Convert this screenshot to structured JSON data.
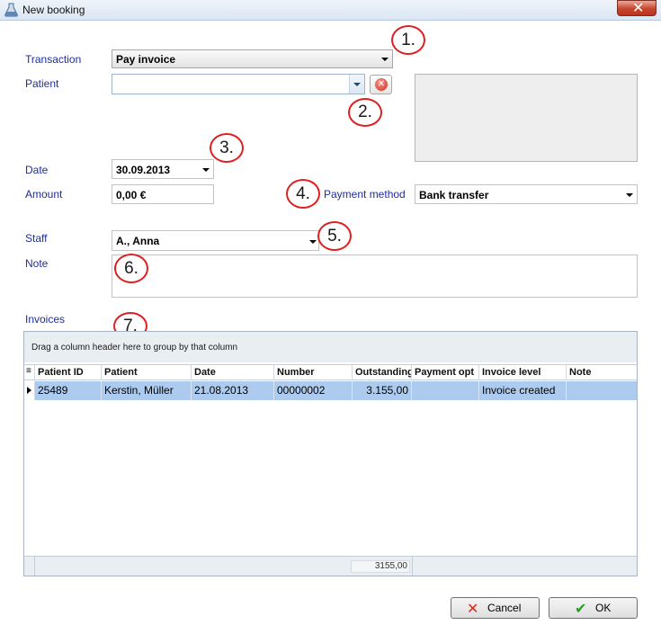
{
  "window": {
    "title": "New booking",
    "close_glyph": "✕"
  },
  "form": {
    "transaction": {
      "label": "Transaction",
      "value": "Pay invoice"
    },
    "patient": {
      "label": "Patient",
      "value": ""
    },
    "date": {
      "label": "Date",
      "value": "30.09.2013"
    },
    "amount": {
      "label": "Amount",
      "value": "0,00 €"
    },
    "payment_method": {
      "label": "Payment method",
      "value": "Bank transfer"
    },
    "staff": {
      "label": "Staff",
      "value": "A., Anna"
    },
    "note": {
      "label": "Note",
      "value": ""
    }
  },
  "annotations": [
    "1.",
    "2.",
    "3.",
    "4.",
    "5.",
    "6.",
    "7."
  ],
  "invoices": {
    "label": "Invoices",
    "group_hint": "Drag a column header here to group by that column",
    "columns": [
      "Patient ID",
      "Patient",
      "Date",
      "Number",
      "Outstanding",
      "Payment opt",
      "Invoice level",
      "Note"
    ],
    "rows": [
      [
        "25489",
        "Kerstin, Müller",
        "21.08.2013",
        "00000002",
        "3.155,00",
        "",
        "Invoice created",
        ""
      ]
    ],
    "total_outstanding": "3155,00"
  },
  "buttons": {
    "cancel": "Cancel",
    "ok": "OK"
  },
  "icons": {
    "app": "booking-flask-icon",
    "clear": "clear-red-x-icon",
    "cancel": "red-x-icon",
    "ok": "green-check-icon",
    "column-chooser": "column-chooser-icon",
    "row-indicator": "row-pointer-icon"
  }
}
